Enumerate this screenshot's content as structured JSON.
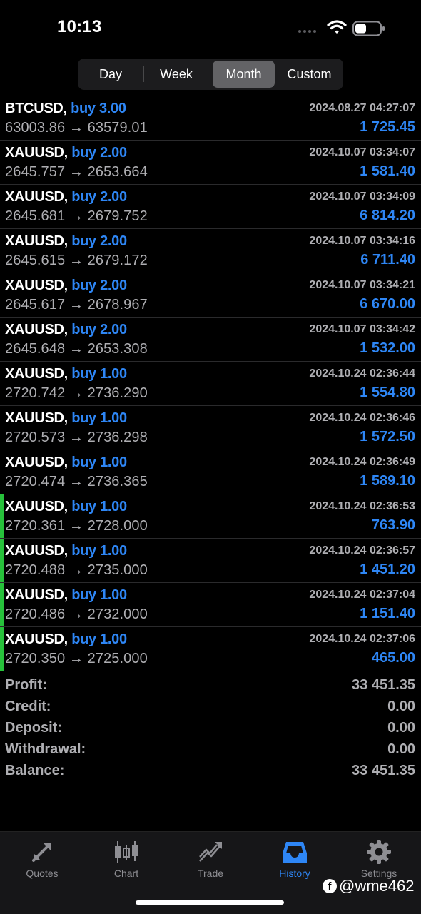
{
  "status": {
    "time": "10:13"
  },
  "periods": [
    "Day",
    "Week",
    "Month",
    "Custom"
  ],
  "active_period": "Month",
  "deals": [
    {
      "symbol": "BTCUSD,",
      "side": "buy 3.00",
      "time": "2024.08.27 04:27:07",
      "prices": "63003.86 → 63579.01",
      "profit": "1 725.45",
      "marked": false
    },
    {
      "symbol": "XAUUSD,",
      "side": "buy 2.00",
      "time": "2024.10.07 03:34:07",
      "prices": "2645.757 → 2653.664",
      "profit": "1 581.40",
      "marked": false
    },
    {
      "symbol": "XAUUSD,",
      "side": "buy 2.00",
      "time": "2024.10.07 03:34:09",
      "prices": "2645.681 → 2679.752",
      "profit": "6 814.20",
      "marked": false
    },
    {
      "symbol": "XAUUSD,",
      "side": "buy 2.00",
      "time": "2024.10.07 03:34:16",
      "prices": "2645.615 → 2679.172",
      "profit": "6 711.40",
      "marked": false
    },
    {
      "symbol": "XAUUSD,",
      "side": "buy 2.00",
      "time": "2024.10.07 03:34:21",
      "prices": "2645.617 → 2678.967",
      "profit": "6 670.00",
      "marked": false
    },
    {
      "symbol": "XAUUSD,",
      "side": "buy 2.00",
      "time": "2024.10.07 03:34:42",
      "prices": "2645.648 → 2653.308",
      "profit": "1 532.00",
      "marked": false
    },
    {
      "symbol": "XAUUSD,",
      "side": "buy 1.00",
      "time": "2024.10.24 02:36:44",
      "prices": "2720.742 → 2736.290",
      "profit": "1 554.80",
      "marked": false
    },
    {
      "symbol": "XAUUSD,",
      "side": "buy 1.00",
      "time": "2024.10.24 02:36:46",
      "prices": "2720.573 → 2736.298",
      "profit": "1 572.50",
      "marked": false
    },
    {
      "symbol": "XAUUSD,",
      "side": "buy 1.00",
      "time": "2024.10.24 02:36:49",
      "prices": "2720.474 → 2736.365",
      "profit": "1 589.10",
      "marked": false
    },
    {
      "symbol": "XAUUSD,",
      "side": "buy 1.00",
      "time": "2024.10.24 02:36:53",
      "prices": "2720.361 → 2728.000",
      "profit": "763.90",
      "marked": true
    },
    {
      "symbol": "XAUUSD,",
      "side": "buy 1.00",
      "time": "2024.10.24 02:36:57",
      "prices": "2720.488 → 2735.000",
      "profit": "1 451.20",
      "marked": true
    },
    {
      "symbol": "XAUUSD,",
      "side": "buy 1.00",
      "time": "2024.10.24 02:37:04",
      "prices": "2720.486 → 2732.000",
      "profit": "1 151.40",
      "marked": true
    },
    {
      "symbol": "XAUUSD,",
      "side": "buy 1.00",
      "time": "2024.10.24 02:37:06",
      "prices": "2720.350 → 2725.000",
      "profit": "465.00",
      "marked": true
    }
  ],
  "summary": [
    {
      "label": "Profit:",
      "value": "33 451.35"
    },
    {
      "label": "Credit:",
      "value": "0.00"
    },
    {
      "label": "Deposit:",
      "value": "0.00"
    },
    {
      "label": "Withdrawal:",
      "value": "0.00"
    },
    {
      "label": "Balance:",
      "value": "33 451.35"
    }
  ],
  "tabs": [
    {
      "label": "Quotes",
      "icon": "quotes-icon"
    },
    {
      "label": "Chart",
      "icon": "chart-icon"
    },
    {
      "label": "Trade",
      "icon": "trade-icon"
    },
    {
      "label": "History",
      "icon": "history-icon"
    },
    {
      "label": "Settings",
      "icon": "settings-icon"
    }
  ],
  "active_tab": "History",
  "watermark": "@wme462",
  "colors": {
    "accent": "#2e86f5",
    "marker": "#27c13b",
    "background": "#000000"
  }
}
